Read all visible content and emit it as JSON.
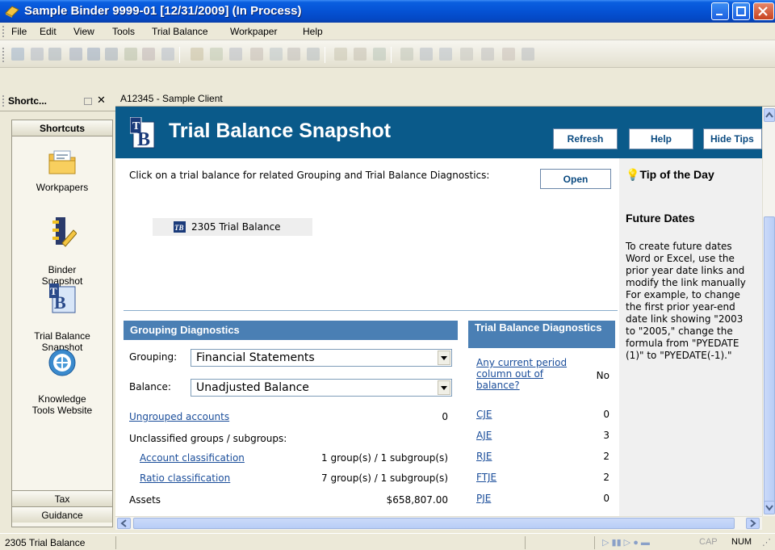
{
  "window": {
    "title": "Sample Binder 9999-01 [12/31/2009] (In Process)"
  },
  "menu": [
    "File",
    "Edit",
    "View",
    "Tools",
    "Trial Balance",
    "Workpaper",
    "Help"
  ],
  "left_pane": {
    "title": "Shortc...",
    "header": "Shortcuts",
    "items": [
      {
        "label": "Workpapers",
        "icon": "folder-icon"
      },
      {
        "label": "Binder\nSnapshot",
        "icon": "binder-snapshot-icon"
      },
      {
        "label": "Trial Balance\nSnapshot",
        "icon": "trial-balance-icon"
      },
      {
        "label": "Knowledge\nTools Website",
        "icon": "knowledge-tools-icon"
      }
    ],
    "bottom_tabs": [
      "Tax",
      "Guidance"
    ]
  },
  "doc_tab": {
    "label": "A12345 - Sample Client"
  },
  "snapshot": {
    "title": "Trial Balance Snapshot",
    "logo_text": "TB",
    "buttons": {
      "refresh": "Refresh",
      "help": "Help",
      "hide_tips": "Hide Tips"
    },
    "intro": "Click on a trial balance for related Grouping and Trial Balance Diagnostics:",
    "open_button": "Open",
    "trial_balance_item": "2305 Trial Balance"
  },
  "tip": {
    "title": "Tip of the Day",
    "subtitle": "Future Dates",
    "body": "To create future dates\nWord or Excel, use the\nprior year date links and\nmodify the link manually\nFor example, to change\nthe first prior year-end\ndate link showing \"2003\nto \"2005,\" change the\nformula from \"PYEDATE\n(1)\" to \"PYEDATE(-1).\""
  },
  "grouping": {
    "header": "Grouping Diagnostics",
    "grouping_label": "Grouping:",
    "grouping_value": "Financial Statements",
    "balance_label": "Balance:",
    "balance_value": "Unadjusted Balance",
    "ungrouped_label": "Ungrouped accounts",
    "ungrouped_value": "0",
    "unclassified_label": "Unclassified groups / subgroups:",
    "account_class_label": "Account classification",
    "account_class_value": "1 group(s) / 1 subgroup(s)",
    "ratio_class_label": "Ratio classification",
    "ratio_class_value": "7 group(s) / 1 subgroup(s)",
    "assets_label": "Assets",
    "assets_value": "$658,807.00"
  },
  "diagnostics": {
    "header": "Trial Balance Diagnostics",
    "out_of_balance_label": "Any current period column out of balance?",
    "out_of_balance_value": "No",
    "rows": [
      {
        "label": "CJE",
        "value": "0"
      },
      {
        "label": "AJE",
        "value": "3"
      },
      {
        "label": "RJE",
        "value": "2"
      },
      {
        "label": "FTJE",
        "value": "2"
      },
      {
        "label": "PJE",
        "value": "0"
      }
    ]
  },
  "status": {
    "text": "2305  Trial Balance",
    "indicators": {
      "cap": "CAP",
      "num": "NUM"
    }
  }
}
